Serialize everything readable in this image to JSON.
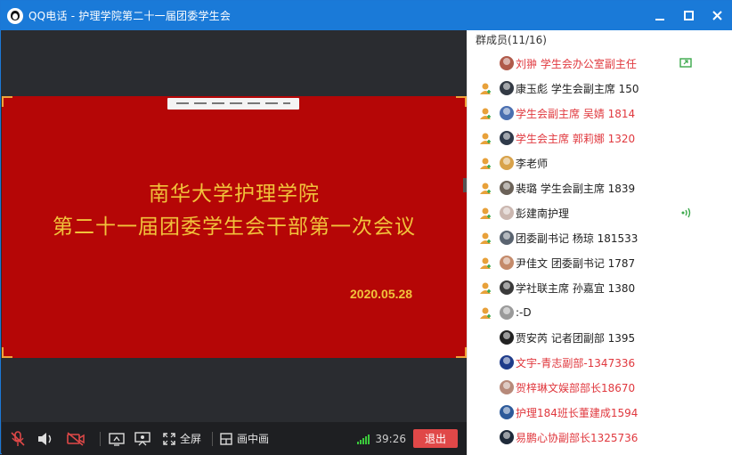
{
  "window": {
    "title": "QQ电话 - 护理学院第二十一届团委学生会"
  },
  "slide": {
    "title_line1": "南华大学护理学院",
    "title_line2": "第二十一届团委学生会干部第一次会议",
    "date": "2020.05.28"
  },
  "controls": {
    "fullscreen_label": "全屏",
    "pip_label": "画中画",
    "timer": "39:26",
    "exit_label": "退出"
  },
  "members": {
    "header": "群成员(11/16)",
    "items": [
      {
        "name": "刘翀 学生会办公室副主任",
        "color": "#e0383e",
        "role": "none",
        "status": "screen-share",
        "avatar_color": "#b05a4a"
      },
      {
        "name": "康玉彪 学生会副主席 150",
        "color": "#222222",
        "role": "member",
        "status": "none",
        "avatar_color": "#333a44"
      },
      {
        "name": "学生会副主席  吴婧 1814",
        "color": "#e0383e",
        "role": "member",
        "status": "none",
        "avatar_color": "#4a6fb0"
      },
      {
        "name": "学生会主席 郭莉娜 1320",
        "color": "#e0383e",
        "role": "member",
        "status": "none",
        "avatar_color": "#2f3a4a"
      },
      {
        "name": "李老师",
        "color": "#222222",
        "role": "member",
        "status": "none",
        "avatar_color": "#d8a24a"
      },
      {
        "name": "裴璐 学生会副主席 1839",
        "color": "#222222",
        "role": "member",
        "status": "none",
        "avatar_color": "#6b6258"
      },
      {
        "name": "彭建南护理",
        "color": "#222222",
        "role": "member",
        "status": "speaking",
        "avatar_color": "#cbb7b0"
      },
      {
        "name": "团委副书记 杨琼 181533",
        "color": "#222222",
        "role": "member",
        "status": "none",
        "avatar_color": "#5a6470"
      },
      {
        "name": "尹佳文 团委副书记 1787",
        "color": "#222222",
        "role": "member",
        "status": "none",
        "avatar_color": "#c48a6a"
      },
      {
        "name": "学社联主席 孙嘉宜 1380",
        "color": "#222222",
        "role": "member",
        "status": "none",
        "avatar_color": "#3a3a3a"
      },
      {
        "name": ":-D",
        "color": "#222222",
        "role": "member",
        "status": "none",
        "avatar_color": "#9a9a9a"
      },
      {
        "name": "贾安芮 记者团副部 1395",
        "color": "#222222",
        "role": "none",
        "status": "none",
        "avatar_color": "#222222"
      },
      {
        "name": "文宇-青志副部-1347336",
        "color": "#e0383e",
        "role": "none",
        "status": "none",
        "avatar_color": "#1f3c8a"
      },
      {
        "name": "贺梓琳文娱部部长18670",
        "color": "#e0383e",
        "role": "none",
        "status": "none",
        "avatar_color": "#b78a7a"
      },
      {
        "name": "护理184班长董建成1594",
        "color": "#e0383e",
        "role": "none",
        "status": "none",
        "avatar_color": "#2d5a9a"
      },
      {
        "name": "易鹏心协副部长1325736",
        "color": "#e0383e",
        "role": "none",
        "status": "none",
        "avatar_color": "#1f2a3a"
      }
    ]
  },
  "colors": {
    "title_bar": "#1a7ad8",
    "slide_bg": "#b50606",
    "slide_text": "#f1c23b",
    "exit_button": "#e04848",
    "role_icon": "#e8a13a",
    "role_icon_plus": "#3aa84a"
  }
}
